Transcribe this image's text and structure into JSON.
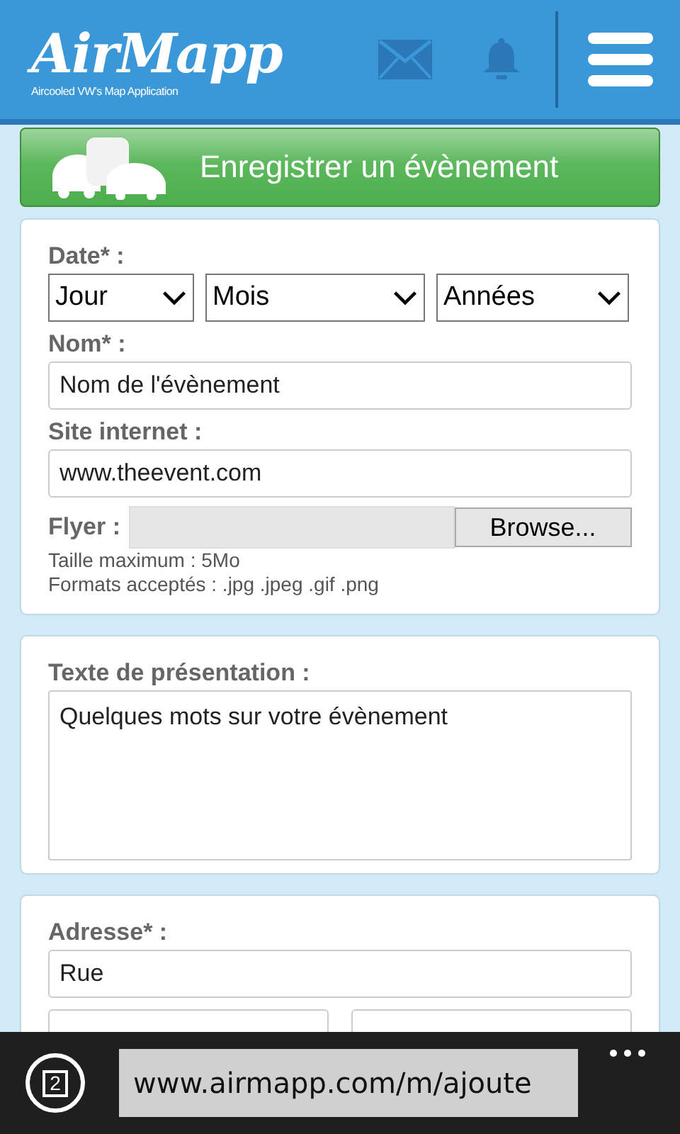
{
  "header": {
    "logo": "AirMapp",
    "tagline": "Aircooled VW's Map Application"
  },
  "action_button": {
    "label": "Enregistrer un évènement"
  },
  "event_card": {
    "date_label": "Date* :",
    "selects": [
      {
        "value": "Jour"
      },
      {
        "value": "Mois"
      },
      {
        "value": "Années"
      }
    ],
    "name_label": "Nom* :",
    "name_placeholder": "Nom de l'évènement",
    "site_label": "Site internet :",
    "site_placeholder": "www.theevent.com",
    "flyer_label": "Flyer :",
    "browse_button": "Browse...",
    "notes": [
      "Taille maximum : 5Mo",
      "Formats acceptés : .jpg .jpeg .gif .png"
    ]
  },
  "presentation_card": {
    "label": "Texte de présentation :",
    "placeholder": "Quelques mots sur votre évènement"
  },
  "address_card": {
    "label": "Adresse* :",
    "street_placeholder": "Rue"
  },
  "browser_bar": {
    "tab_count": "2",
    "url": "www.airmapp.com/m/ajoute"
  }
}
